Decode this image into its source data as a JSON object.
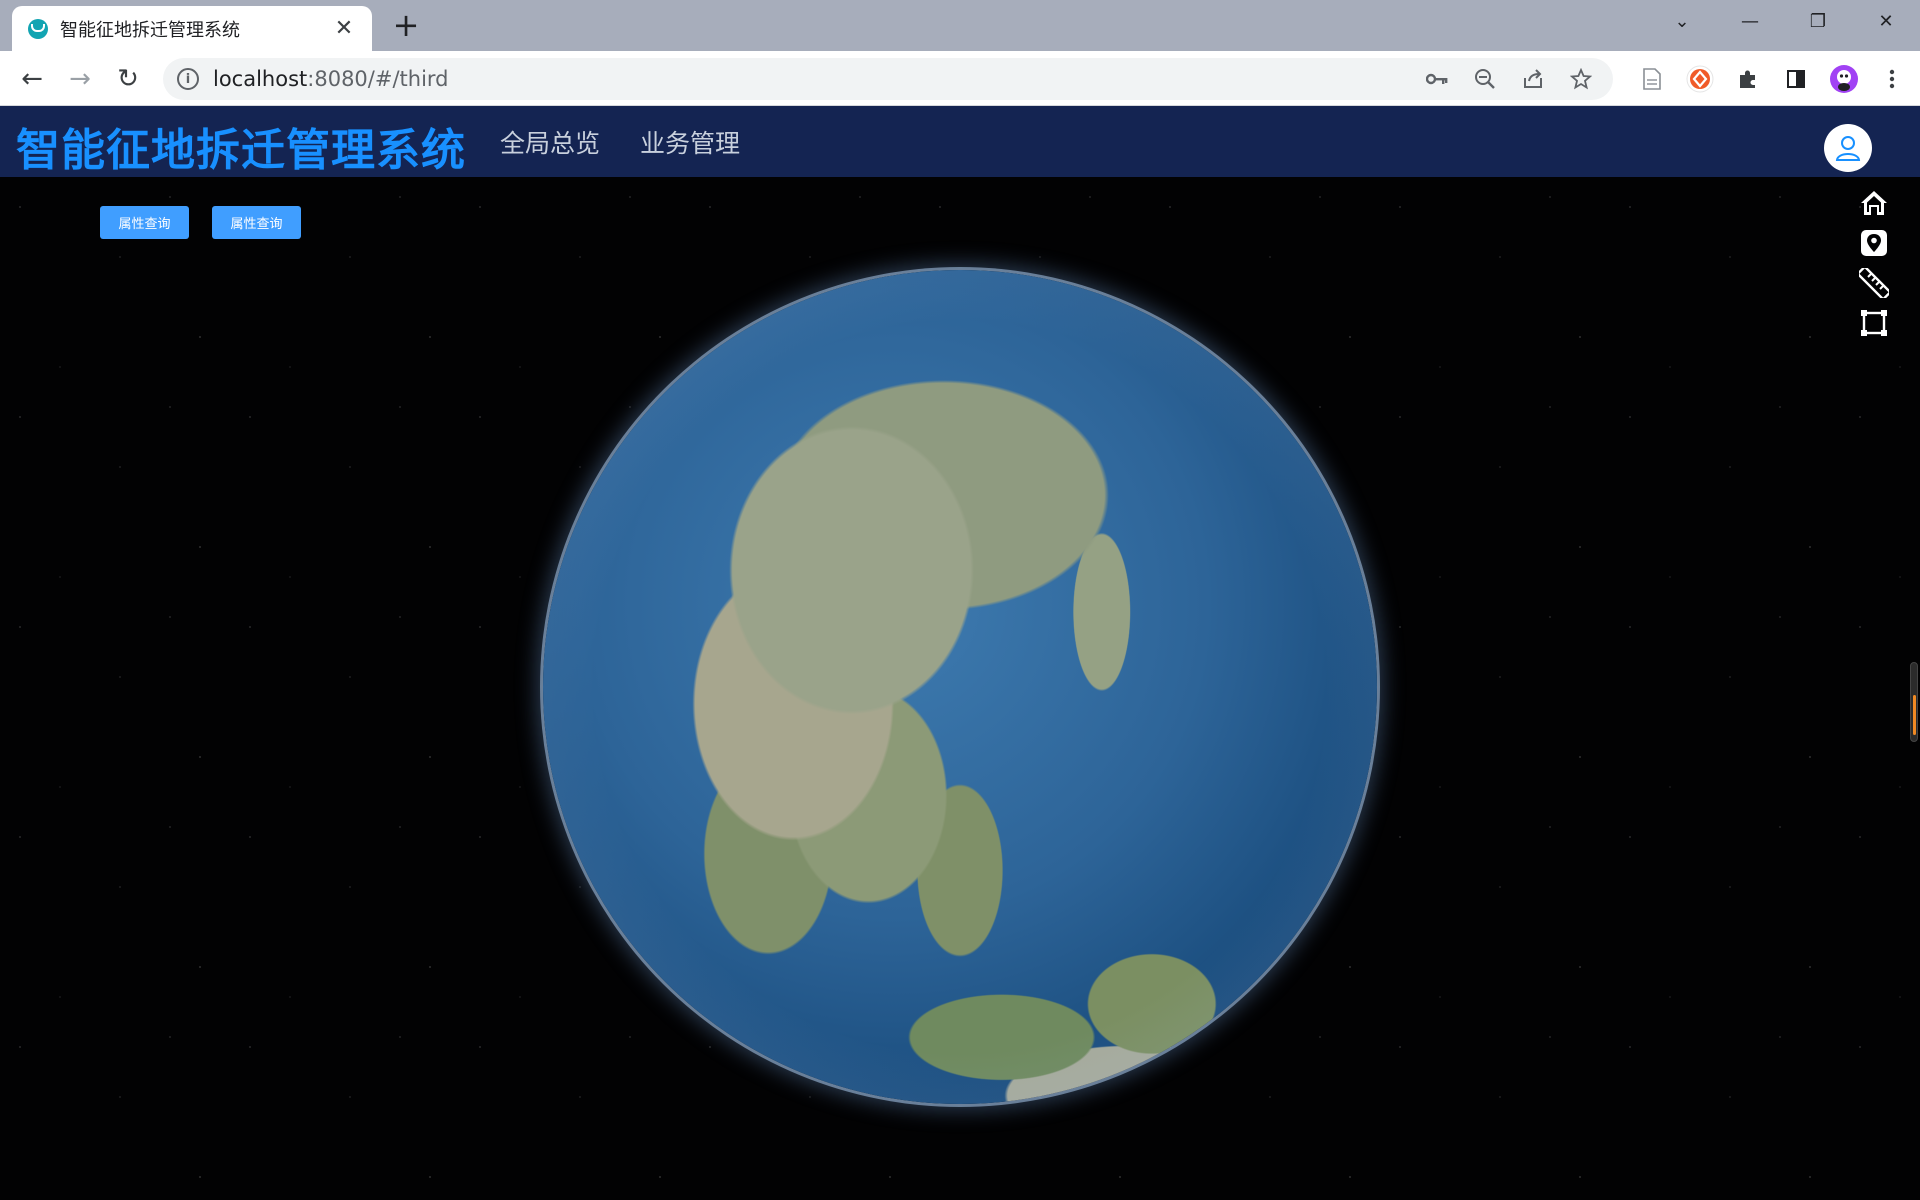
{
  "browser": {
    "tab_title": "智能征地拆迁管理系统",
    "url_host": "localhost",
    "url_path": ":8080/#/third",
    "favicon_color": "#12a4b2"
  },
  "app": {
    "title": "智能征地拆迁管理系统",
    "title_color": "#1890ff",
    "header_color": "#142452",
    "menu": [
      {
        "label": "全局总览"
      },
      {
        "label": "业务管理"
      }
    ],
    "buttons": [
      {
        "label": "属性查询"
      },
      {
        "label": "属性查询"
      }
    ],
    "button_color": "#409eff",
    "map_tools": [
      "home-icon",
      "location-pin-icon",
      "ruler-icon",
      "area-measure-icon"
    ]
  }
}
